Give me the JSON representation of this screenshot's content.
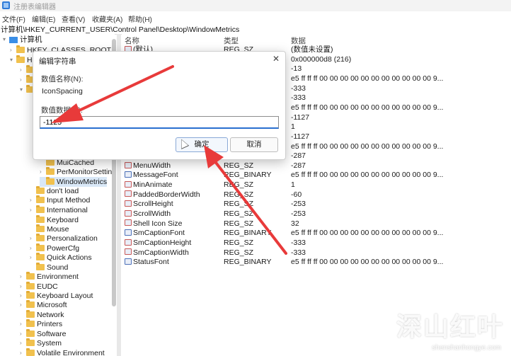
{
  "window": {
    "title": "注册表编辑器"
  },
  "menu": [
    "文件(F)",
    "编辑(E)",
    "查看(V)",
    "收藏夹(A)",
    "帮助(H)"
  ],
  "address": "计算机\\HKEY_CURRENT_USER\\Control Panel\\Desktop\\WindowMetrics",
  "tree": [
    {
      "label": "计算机",
      "icon": "computer"
    },
    {
      "label": "HKEY_CLASSES_ROOT",
      "icon": "folder"
    },
    {
      "label": "H",
      "icon": "folder"
    },
    {
      "label": "",
      "icon": "folder"
    },
    {
      "label": "",
      "icon": "folder"
    },
    {
      "label": "",
      "icon": "folder"
    },
    {
      "label": "MuiCached",
      "icon": "folder"
    },
    {
      "label": "PerMonitorSettin",
      "icon": "folder"
    },
    {
      "label": "WindowMetrics",
      "icon": "folder"
    },
    {
      "label": "don't load",
      "icon": "folder"
    },
    {
      "label": "Input Method",
      "icon": "folder"
    },
    {
      "label": "International",
      "icon": "folder"
    },
    {
      "label": "Keyboard",
      "icon": "folder"
    },
    {
      "label": "Mouse",
      "icon": "folder"
    },
    {
      "label": "Personalization",
      "icon": "folder"
    },
    {
      "label": "PowerCfg",
      "icon": "folder"
    },
    {
      "label": "Quick Actions",
      "icon": "folder"
    },
    {
      "label": "Sound",
      "icon": "folder"
    },
    {
      "label": "Environment",
      "icon": "folder"
    },
    {
      "label": "EUDC",
      "icon": "folder"
    },
    {
      "label": "Keyboard Layout",
      "icon": "folder"
    },
    {
      "label": "Microsoft",
      "icon": "folder"
    },
    {
      "label": "Network",
      "icon": "folder"
    },
    {
      "label": "Printers",
      "icon": "folder"
    },
    {
      "label": "Software",
      "icon": "folder"
    },
    {
      "label": "System",
      "icon": "folder"
    },
    {
      "label": "Volatile Environment",
      "icon": "folder"
    }
  ],
  "columns": {
    "name": "名称",
    "type": "类型",
    "data": "数据"
  },
  "values": [
    {
      "name": "(默认)",
      "type": "REG_SZ",
      "data": "(数值未设置)",
      "icon": "sz"
    },
    {
      "name": "",
      "type": "",
      "data": "0x000000d8 (216)",
      "icon": "bin"
    },
    {
      "name": "",
      "type": "",
      "data": "-13",
      "icon": "sz"
    },
    {
      "name": "",
      "type": "",
      "data": "e5 ff ff ff 00 00 00 00 00 00 00 00 00 00 00 9...",
      "icon": "bin"
    },
    {
      "name": "",
      "type": "",
      "data": "-333",
      "icon": "sz"
    },
    {
      "name": "",
      "type": "",
      "data": "-333",
      "icon": "sz"
    },
    {
      "name": "",
      "type": "",
      "data": "e5 ff ff ff 00 00 00 00 00 00 00 00 00 00 00 9...",
      "icon": "bin"
    },
    {
      "name": "",
      "type": "",
      "data": "-1127",
      "icon": "sz"
    },
    {
      "name": "",
      "type": "",
      "data": "1",
      "icon": "sz"
    },
    {
      "name": "",
      "type": "",
      "data": "-1127",
      "icon": "sz"
    },
    {
      "name": "",
      "type": "",
      "data": "e5 ff ff ff 00 00 00 00 00 00 00 00 00 00 00 9...",
      "icon": "bin"
    },
    {
      "name": "MenuHeight",
      "type": "REG_SZ",
      "data": "-287",
      "icon": "sz"
    },
    {
      "name": "MenuWidth",
      "type": "REG_SZ",
      "data": "-287",
      "icon": "sz"
    },
    {
      "name": "MessageFont",
      "type": "REG_BINARY",
      "data": "e5 ff ff ff 00 00 00 00 00 00 00 00 00 00 00 9...",
      "icon": "bin"
    },
    {
      "name": "MinAnimate",
      "type": "REG_SZ",
      "data": "1",
      "icon": "sz"
    },
    {
      "name": "PaddedBorderWidth",
      "type": "REG_SZ",
      "data": "-60",
      "icon": "sz"
    },
    {
      "name": "ScrollHeight",
      "type": "REG_SZ",
      "data": "-253",
      "icon": "sz"
    },
    {
      "name": "ScrollWidth",
      "type": "REG_SZ",
      "data": "-253",
      "icon": "sz"
    },
    {
      "name": "Shell Icon Size",
      "type": "REG_SZ",
      "data": "32",
      "icon": "sz"
    },
    {
      "name": "SmCaptionFont",
      "type": "REG_BINARY",
      "data": "e5 ff ff ff 00 00 00 00 00 00 00 00 00 00 00 9...",
      "icon": "bin"
    },
    {
      "name": "SmCaptionHeight",
      "type": "REG_SZ",
      "data": "-333",
      "icon": "sz"
    },
    {
      "name": "SmCaptionWidth",
      "type": "REG_SZ",
      "data": "-333",
      "icon": "sz"
    },
    {
      "name": "StatusFont",
      "type": "REG_BINARY",
      "data": "e5 ff ff ff 00 00 00 00 00 00 00 00 00 00 00 9...",
      "icon": "bin"
    }
  ],
  "dialog": {
    "title": "编辑字符串",
    "close_glyph": "✕",
    "name_label": "数值名称(N):",
    "name_value": "IconSpacing",
    "data_label": "数值数据(V):",
    "data_value": "-1125",
    "ok_label": "确定",
    "cancel_label": "取消"
  },
  "watermark": {
    "main": "深山红叶",
    "sub": "shenshanhongye.com"
  },
  "colors": {
    "arrow": "#e83a3a",
    "selection": "#d9e8f7",
    "accent": "#2a6fd0"
  }
}
